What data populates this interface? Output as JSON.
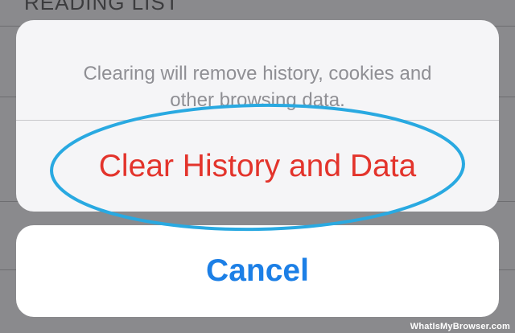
{
  "background_page": {
    "section_heading": "READING LIST"
  },
  "action_sheet": {
    "message_line_1": "Clearing will remove history, cookies and",
    "message_line_2": "other browsing data.",
    "destructive_label": "Clear History and Data"
  },
  "cancel": {
    "label": "Cancel"
  },
  "annotation": {
    "highlight_color": "#29a9e1"
  },
  "watermark": "WhatIsMyBrowser.com",
  "colors": {
    "destructive": "#e3342c",
    "cancel": "#1c7fe6",
    "message": "#8f8f94"
  }
}
